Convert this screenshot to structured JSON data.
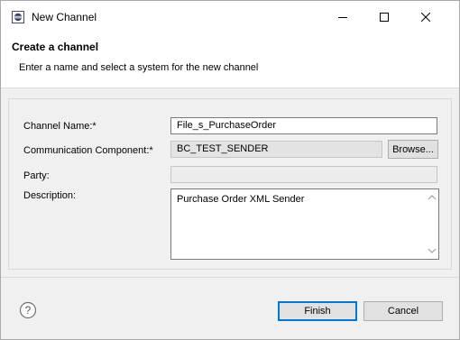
{
  "window": {
    "title": "New Channel"
  },
  "header": {
    "title": "Create a channel",
    "subtitle": "Enter a name and select a system for the new channel"
  },
  "form": {
    "channel_name_label": "Channel Name:*",
    "channel_name_value": "File_s_PurchaseOrder",
    "component_label": "Communication Component:*",
    "component_value": "BC_TEST_SENDER",
    "browse_label": "Browse...",
    "party_label": "Party:",
    "party_value": "",
    "description_label": "Description:",
    "description_value": "Purchase Order XML Sender"
  },
  "footer": {
    "finish_label": "Finish",
    "cancel_label": "Cancel"
  },
  "icons": {
    "app": "eclipse-icon",
    "minimize": "minimize-icon",
    "maximize": "maximize-icon",
    "close": "close-icon",
    "help": "help-icon",
    "scroll_up": "chevron-up-icon",
    "scroll_down": "chevron-down-icon"
  },
  "colors": {
    "accent": "#0078d7",
    "window_bg": "#f0f0f0"
  }
}
